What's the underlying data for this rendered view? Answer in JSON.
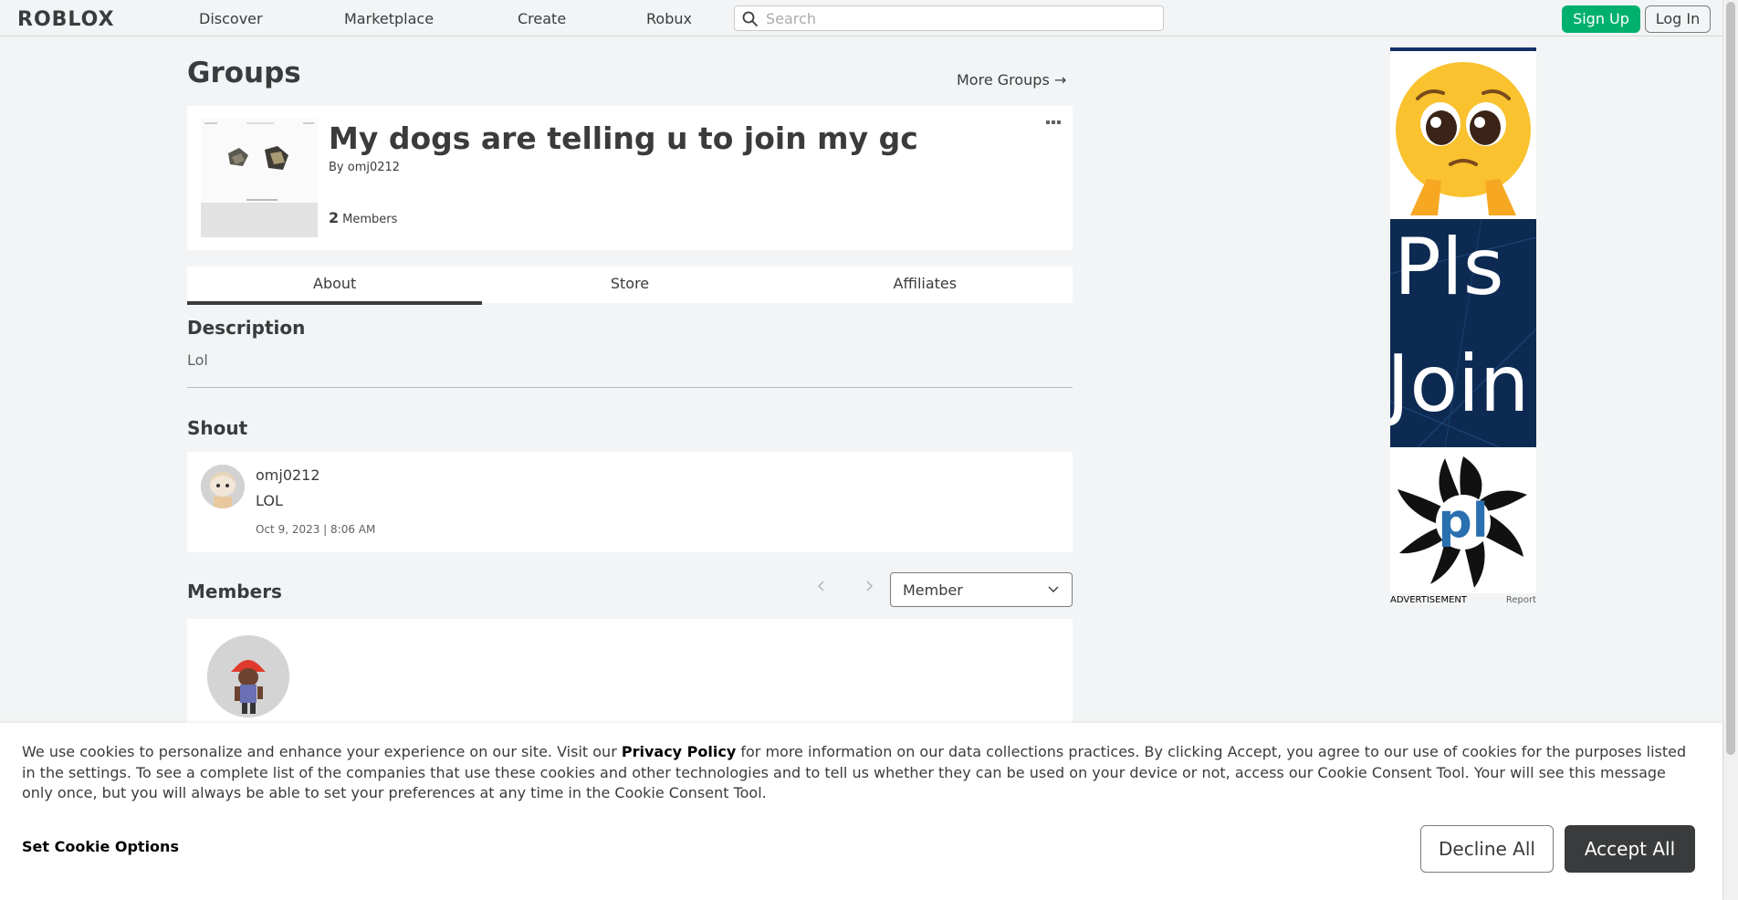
{
  "nav": {
    "logo": "ROBLOX",
    "links": [
      "Discover",
      "Marketplace",
      "Create",
      "Robux"
    ],
    "search_placeholder": "Search",
    "signup": "Sign Up",
    "login": "Log In"
  },
  "page": {
    "title": "Groups",
    "more_groups": "More Groups →"
  },
  "group": {
    "name": "My dogs are telling u to join my gc",
    "by_label": "By",
    "owner": "omj0212",
    "member_count": "2",
    "members_label": "Members"
  },
  "tabs": [
    "About",
    "Store",
    "Affiliates"
  ],
  "description": {
    "title": "Description",
    "text": "Lol"
  },
  "shout": {
    "title": "Shout",
    "user": "omj0212",
    "text": "LOL",
    "date": "Oct 9, 2023 | 8:06 AM"
  },
  "members": {
    "title": "Members",
    "role_select": "Member"
  },
  "ad": {
    "line1": "Pls",
    "line2": "Join",
    "logo_text": "pl",
    "label": "ADVERTISEMENT",
    "report": "Report"
  },
  "cookie": {
    "text_before": "We use cookies to personalize and enhance your experience on our site. Visit our ",
    "privacy_link": "Privacy Policy",
    "text_after": " for more information on our data collections practices. By clicking Accept, you agree to our use of cookies for the purposes listed in the settings. To see a complete list of the companies that use these cookies and other technologies and to tell us whether they can be used on your device or not, access our Cookie Consent Tool. Your will see this message only once, but you will always be able to set your preferences at any time in the Cookie Consent Tool.",
    "set_options": "Set Cookie Options",
    "decline": "Decline All",
    "accept": "Accept All"
  },
  "colors": {
    "accent_green": "#00b06f",
    "text_dark": "#393b3d",
    "page_bg": "#f2f4f5",
    "ad_blue": "#0d2a52"
  }
}
